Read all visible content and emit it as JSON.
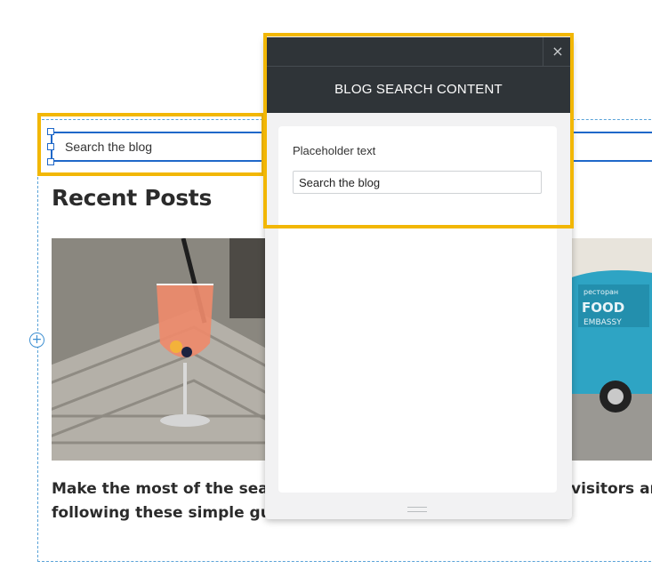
{
  "canvas": {
    "search_text": "Search the blog",
    "section_heading": "Recent Posts",
    "add_symbol": "+",
    "posts": [
      {
        "title_line1": "Make the most of the seas",
        "title_line2": "following these simple gui"
      },
      {
        "title_line1": "visitors ar",
        "title_line2": ""
      }
    ]
  },
  "panel": {
    "title": "BLOG SEARCH CONTENT",
    "close_symbol": "×",
    "placeholder_label": "Placeholder text",
    "placeholder_value": "Search the blog"
  },
  "colors": {
    "highlight": "#f2b705",
    "selection": "#1f68c9",
    "panel_header": "#2f3438"
  }
}
